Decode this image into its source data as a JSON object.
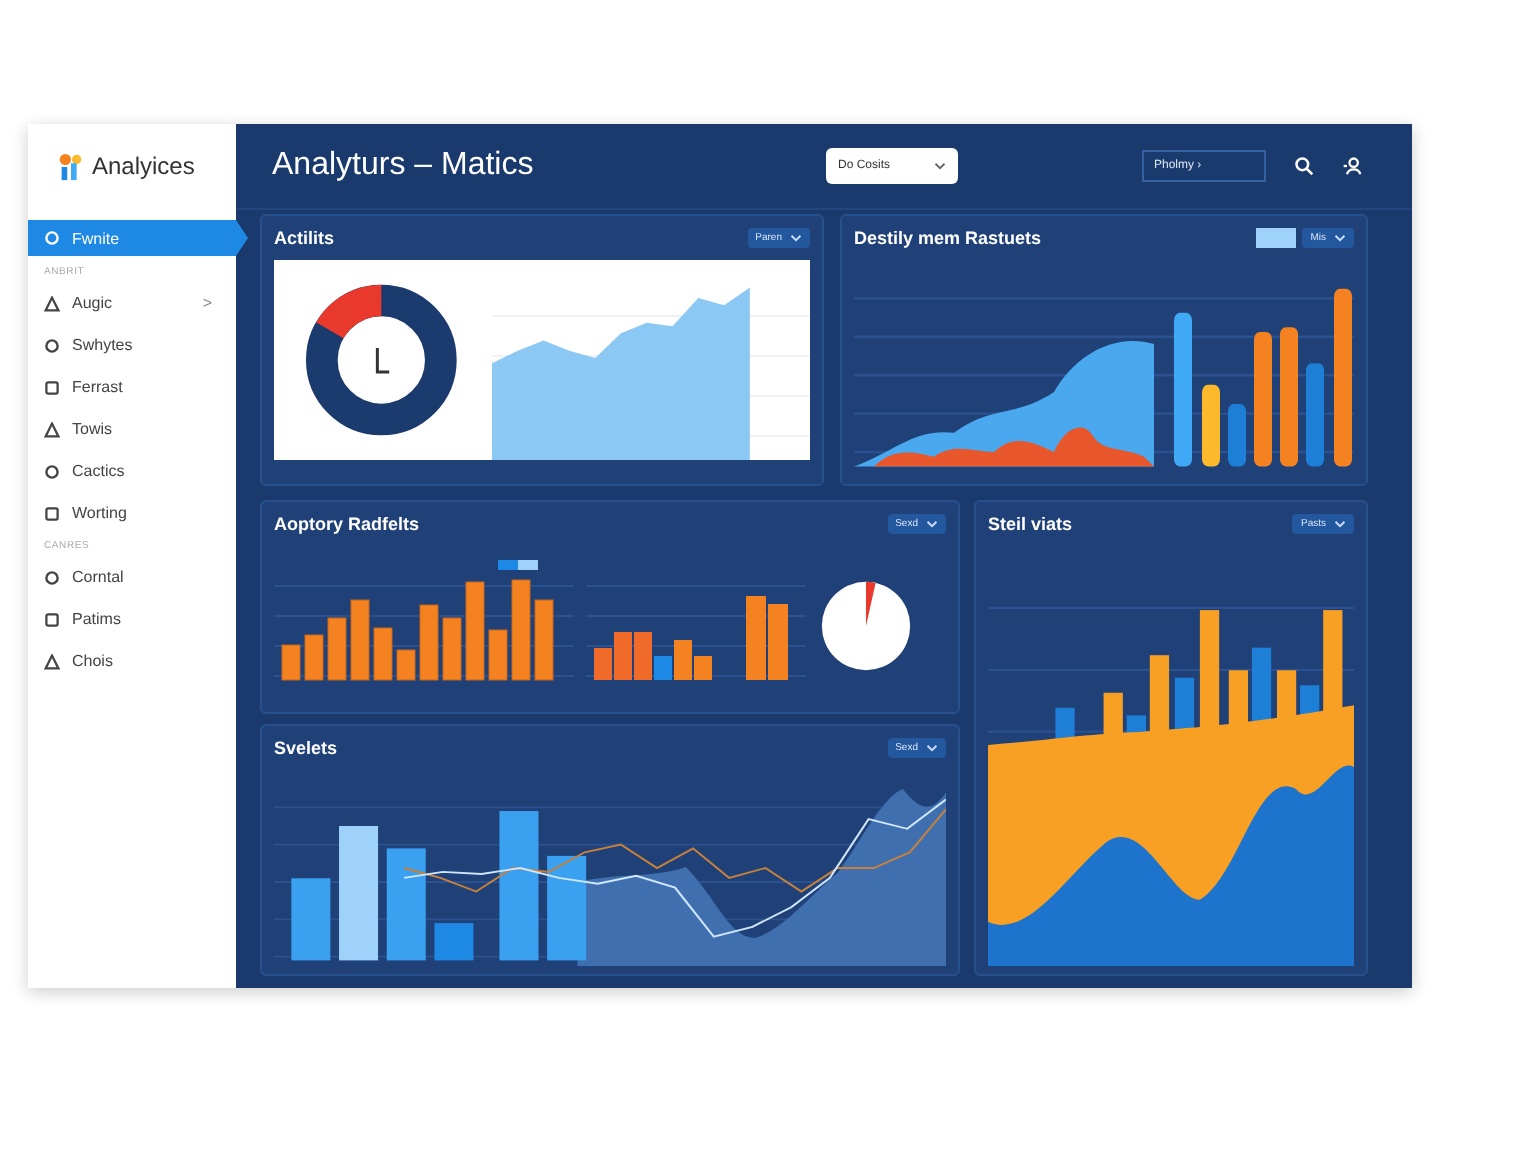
{
  "sidebar": {
    "logo": "Analyices",
    "items": [
      {
        "kind": "item",
        "label": "Fwnite",
        "selected": true
      },
      {
        "kind": "section",
        "label": "ANBRIT"
      },
      {
        "kind": "item",
        "label": "Augic",
        "selected": false,
        "arrow": ">"
      },
      {
        "kind": "item",
        "label": "Swhytes",
        "selected": false
      },
      {
        "kind": "item",
        "label": "Ferrast",
        "selected": false
      },
      {
        "kind": "item",
        "label": "Towis",
        "selected": false
      },
      {
        "kind": "item",
        "label": "Cactics",
        "selected": false
      },
      {
        "kind": "item",
        "label": "Worting",
        "selected": false
      },
      {
        "kind": "section",
        "label": "CANRES"
      },
      {
        "kind": "item",
        "label": "Corntal",
        "selected": false
      },
      {
        "kind": "item",
        "label": "Patims",
        "selected": false
      },
      {
        "kind": "item",
        "label": "Chois",
        "selected": false
      }
    ]
  },
  "header": {
    "title": "Analyturs – Matics",
    "select": "Do Cosits",
    "field": "Pholmy ›"
  },
  "cards": [
    {
      "title": "Actilits",
      "dropdown": "Paren"
    },
    {
      "title": "Destily mem Rastuets",
      "dropdown": "Mis",
      "toggle_on": true
    },
    {
      "title": "Aoptory Radfelts",
      "dropdown": "Sexd"
    },
    {
      "title": "Svelets",
      "dropdown": "Sexd"
    },
    {
      "title": "Steil viats",
      "dropdown": "Pasts"
    }
  ]
}
